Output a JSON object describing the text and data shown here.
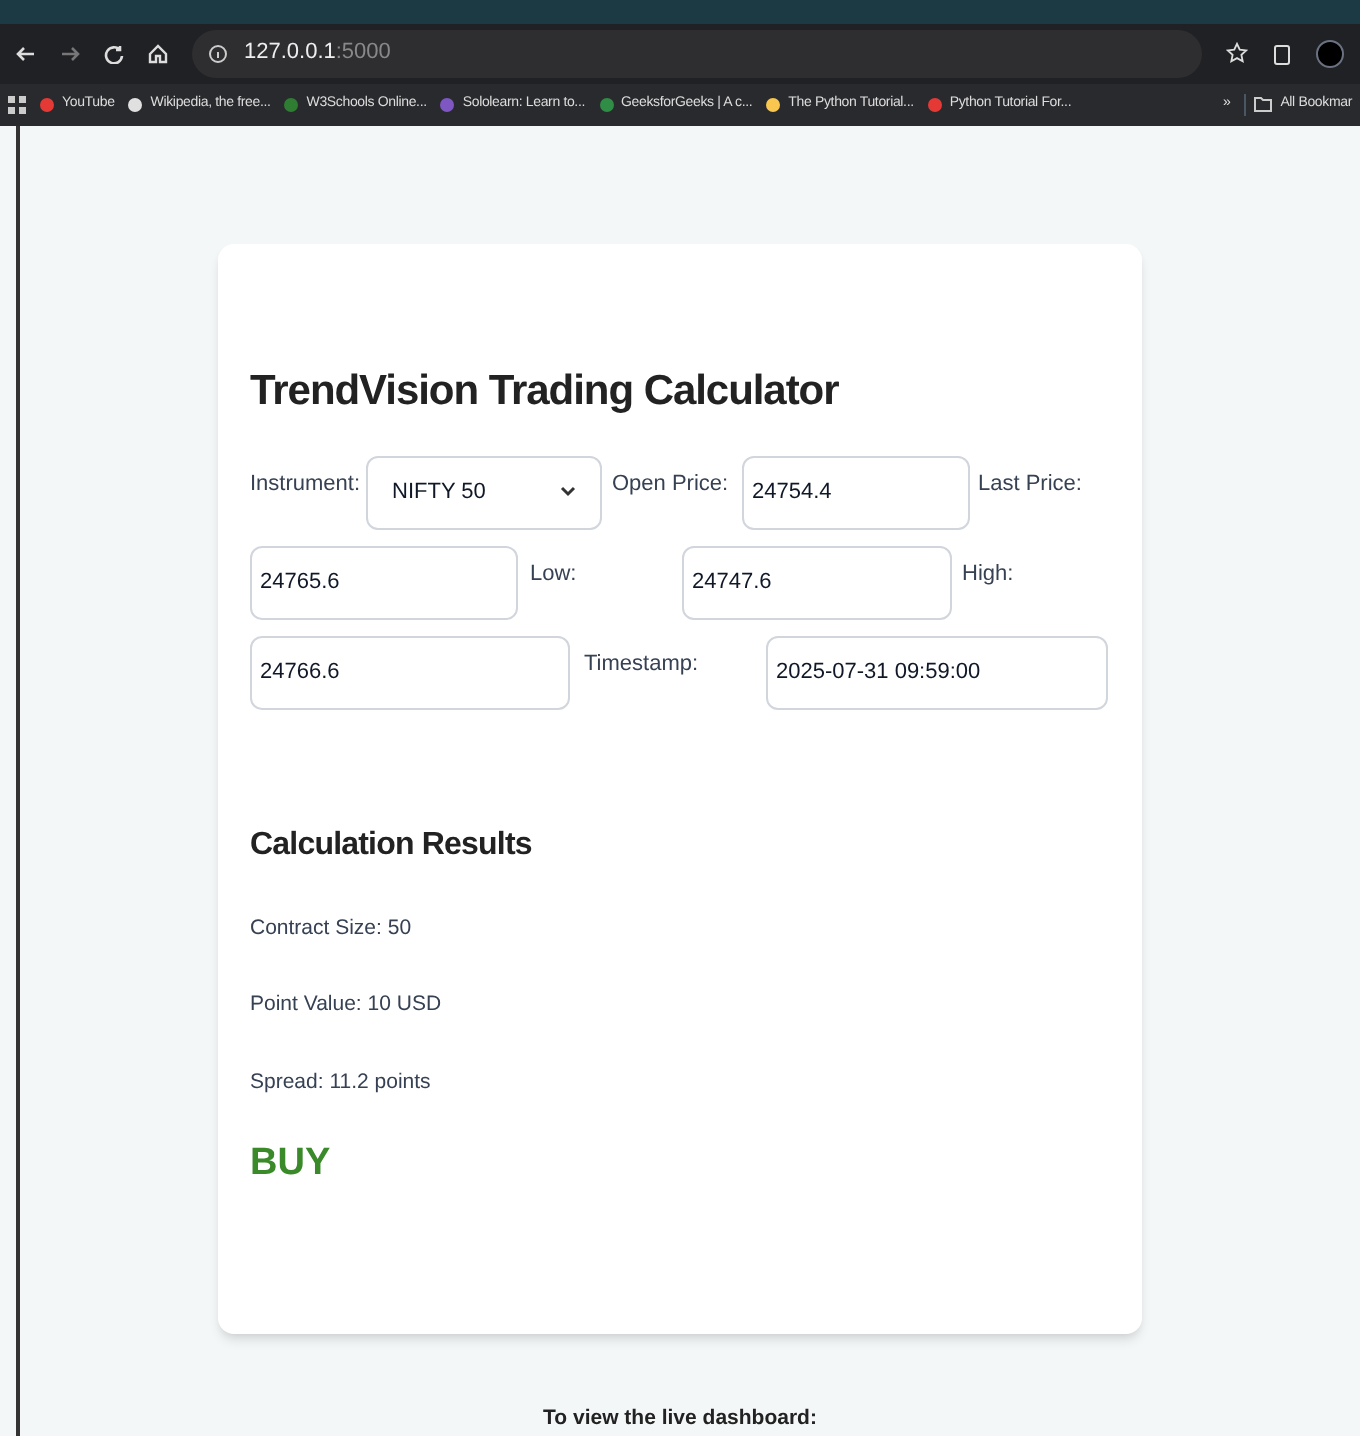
{
  "browser": {
    "url_host": "127.0.0.1",
    "url_port": ":5000",
    "bookmarks": [
      {
        "label": "YouTube",
        "color": "#e53935"
      },
      {
        "label": "Wikipedia, the free...",
        "color": "#e0e0e0"
      },
      {
        "label": "W3Schools Online...",
        "color": "#2e7d32"
      },
      {
        "label": "Sololearn: Learn to...",
        "color": "#7e57c2"
      },
      {
        "label": "GeeksforGeeks | A c...",
        "color": "#2f8d46"
      },
      {
        "label": "The Python Tutorial...",
        "color": "#f9c74f"
      },
      {
        "label": "Python Tutorial For...",
        "color": "#e53935"
      }
    ],
    "more": "»",
    "all_bookmarks": "All Bookmar"
  },
  "card": {
    "title": "TrendVision Trading Calculator",
    "fields": [
      {
        "label": "Instrument:",
        "kind": "select",
        "value": "NIFTY 50"
      },
      {
        "label": "Open Price:",
        "kind": "input",
        "value": "24754.4"
      },
      {
        "label": "Last Price:",
        "kind": "input",
        "value": "24765.6"
      },
      {
        "label": "Low:",
        "kind": "input",
        "value": "24747.6"
      },
      {
        "label": "High:",
        "kind": "input",
        "value": "24766.6"
      },
      {
        "label": "Timestamp:",
        "kind": "input",
        "value": "2025-07-31 09:59:00"
      }
    ],
    "results_title": "Calculation Results",
    "results": [
      "Contract Size: 50",
      "Point Value: 10 USD",
      "Spread: 11.2 points"
    ],
    "signal": {
      "text": "BUY",
      "color": "#3a8a2a"
    }
  },
  "footer": "To view the live dashboard:"
}
